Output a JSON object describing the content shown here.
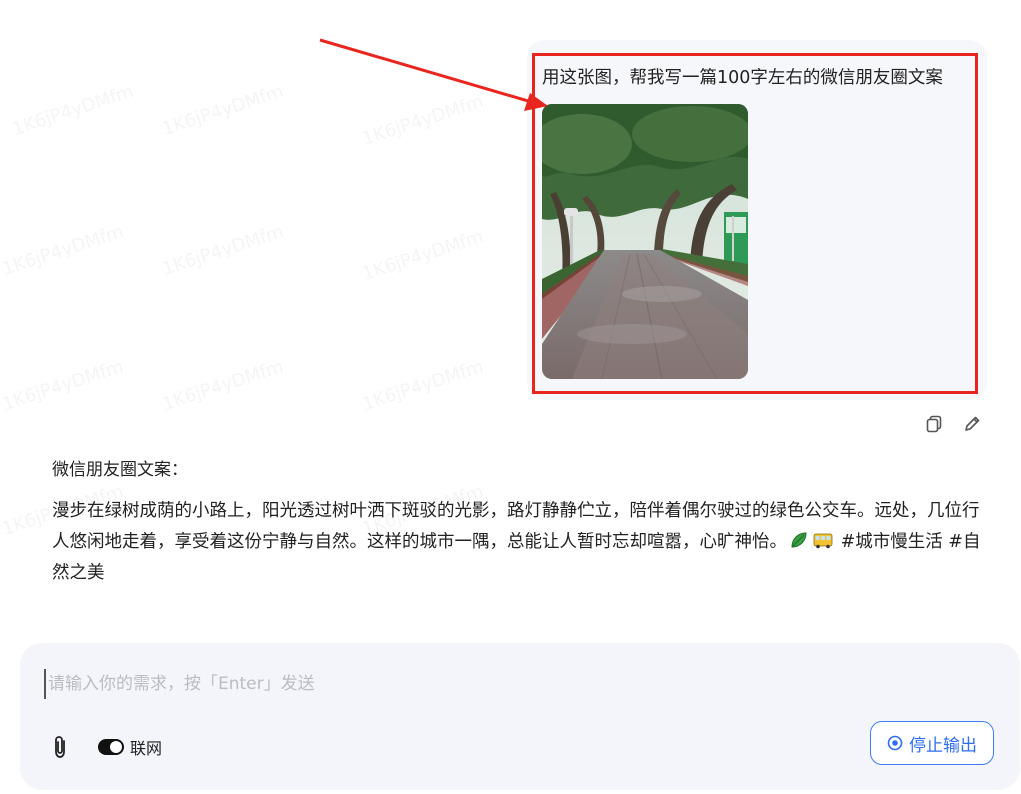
{
  "watermark": {
    "text": "1K6jP4yDMfm"
  },
  "user_message": {
    "text": "用这张图，帮我写一篇100字左右的微信朋友圈文案",
    "image_alt": "tree-lined street photo"
  },
  "message_actions": {
    "copy_icon": "copy-icon",
    "edit_icon": "pencil-icon"
  },
  "reply": {
    "title": "微信朋友圈文案：",
    "body_part1": "漫步在绿树成荫的小路上，阳光透过树叶洒下斑驳的光影，路灯静静伫立，陪伴着偶尔驶过的绿色公交车。远处，几位行人悠闲地走着，享受着这份宁静与自然。这样的城市一隅，总能让人暂时忘却喧嚣，心旷神怡。",
    "emoji_1": "leaf-emoji",
    "emoji_2": "bus-emoji",
    "body_part2": " #城市慢生活 #自然之美"
  },
  "composer": {
    "placeholder": "请输入你的需求，按「Enter」发送",
    "value": "",
    "attach_icon": "paperclip-icon",
    "network_label": "联网",
    "network_enabled": true,
    "stop_button_label": "停止输出",
    "stop_icon": "stop-circle-icon"
  },
  "colors": {
    "highlight": "#e8261f",
    "accent": "#2f6ef0",
    "bubble_bg": "#f6f7fb",
    "composer_bg": "#f4f5fa"
  }
}
